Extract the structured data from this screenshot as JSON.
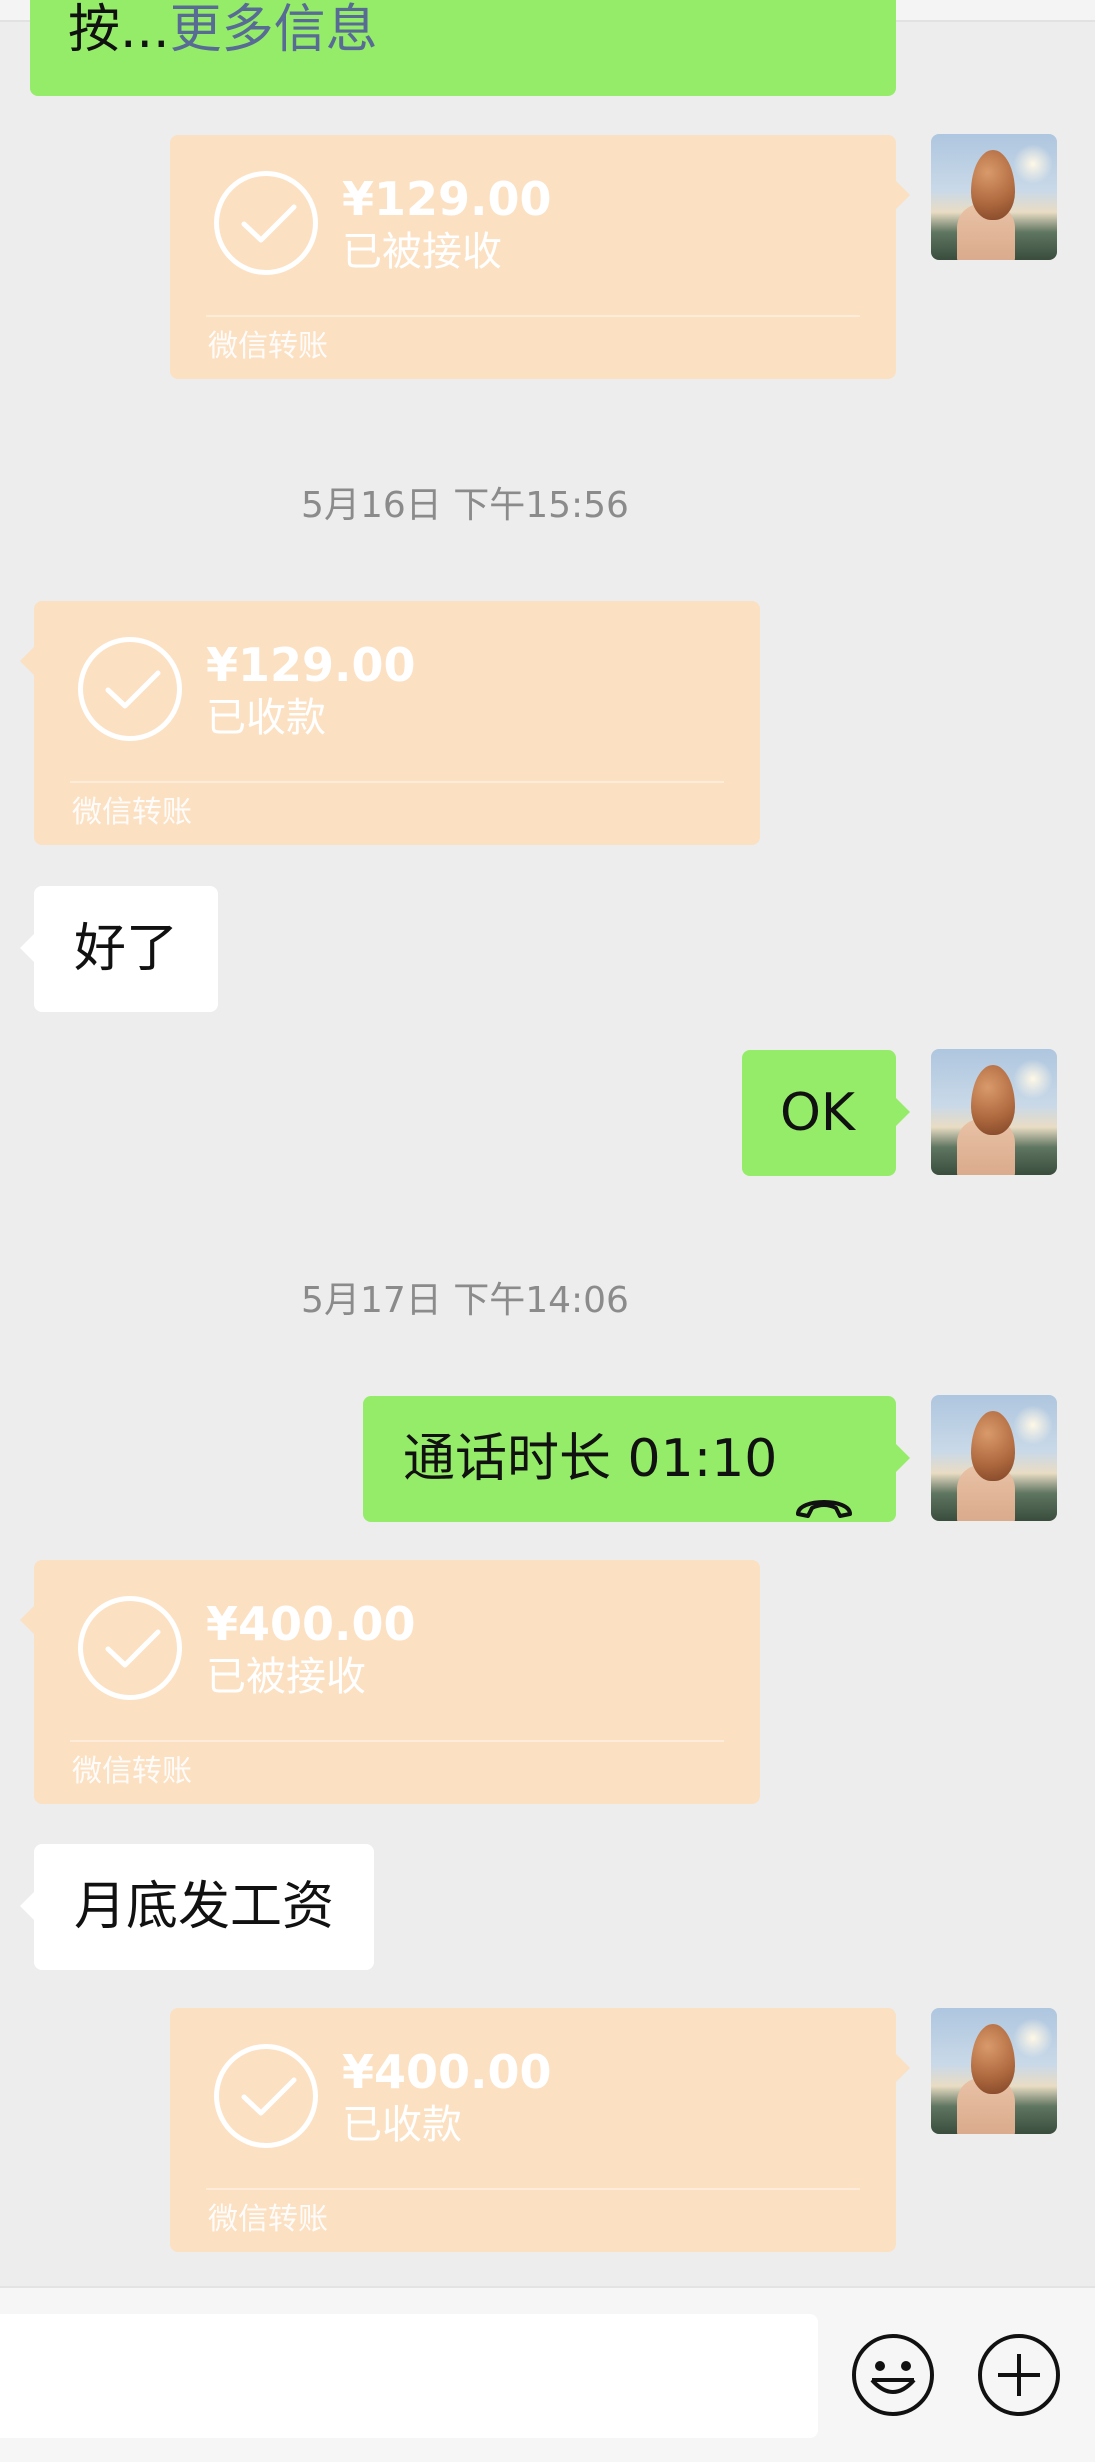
{
  "top_bubble": {
    "prefix": "按...",
    "link": "更多信息"
  },
  "messages": {
    "t1": {
      "amount": "¥129.00",
      "status": "已被接收",
      "foot": "微信转账"
    },
    "ts1": "5月16日 下午15:56",
    "t2": {
      "amount": "¥129.00",
      "status": "已收款",
      "foot": "微信转账"
    },
    "m1": "好了",
    "m2": "OK",
    "ts2": "5月17日 下午14:06",
    "call": {
      "label": "通话时长 01:10",
      "icon": "phone-hangup-icon"
    },
    "t3": {
      "amount": "¥400.00",
      "status": "已被接收",
      "foot": "微信转账"
    },
    "m3": "月底发工资",
    "t4": {
      "amount": "¥400.00",
      "status": "已收款",
      "foot": "微信转账"
    }
  },
  "bottom": {
    "emoji_icon": "emoji-icon",
    "plus_icon": "plus-icon"
  },
  "colors": {
    "background": "#ededed",
    "green_bubble": "#95ec69",
    "transfer_card": "#fce0c2",
    "white_bubble": "#ffffff"
  }
}
